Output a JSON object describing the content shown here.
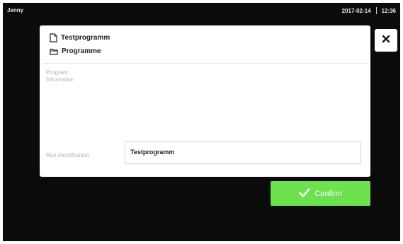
{
  "statusbar": {
    "user": "Jenny",
    "date": "2017-02-14",
    "time": "12:36"
  },
  "dialog": {
    "file_name": "Testprogramm",
    "folder_name": "Programme",
    "program_information_label": "Program Information",
    "run_identification_label": "Run identification",
    "run_identification_value": "Testprogramm"
  },
  "buttons": {
    "confirm_label": "Confirm"
  },
  "icons": {
    "file": "file-icon",
    "folder": "folder-icon",
    "close": "close-icon",
    "check": "check-icon"
  },
  "colors": {
    "background": "#0b0b0b",
    "confirm": "#6de24f",
    "label": "#a6b6b8"
  }
}
